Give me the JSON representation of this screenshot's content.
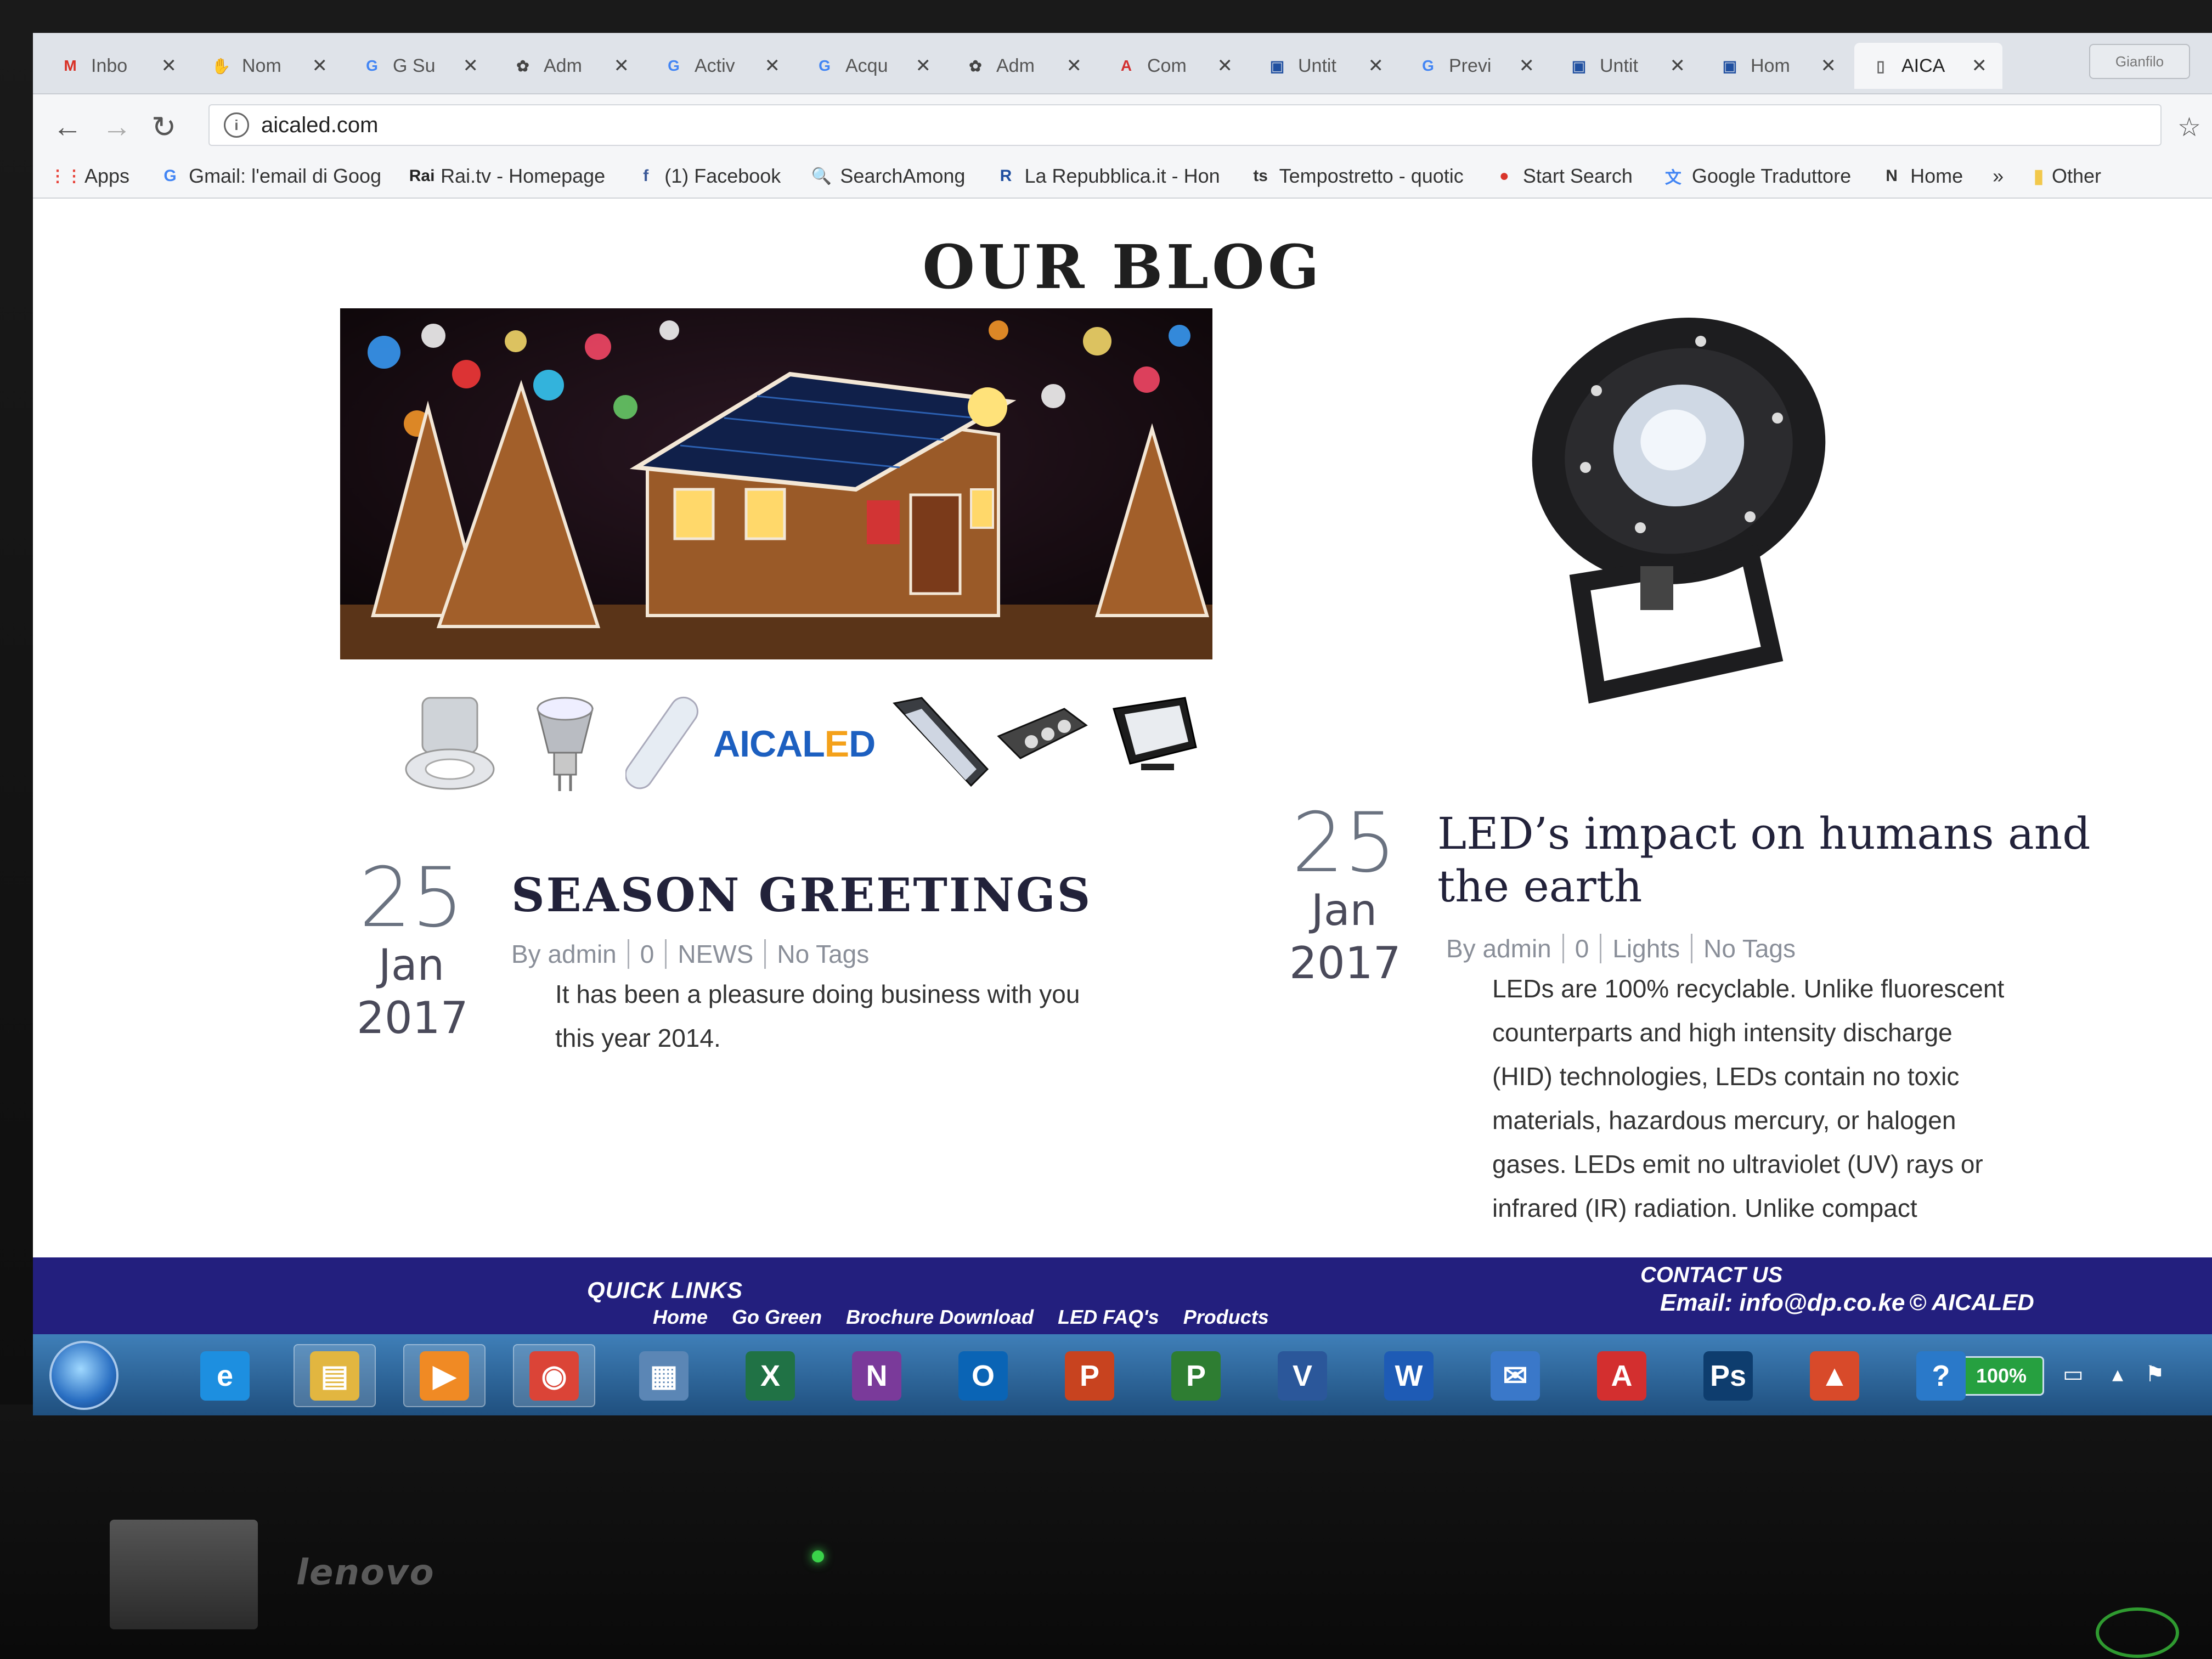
{
  "browser": {
    "tabs": [
      {
        "label": "Inbo",
        "icon": "gmail-icon",
        "glyph": "M",
        "color": "#d93025",
        "bg": "transparent"
      },
      {
        "label": "Nom",
        "icon": "hand-icon",
        "glyph": "✋",
        "color": "#666",
        "bg": "transparent"
      },
      {
        "label": "G Su",
        "icon": "google-icon",
        "glyph": "G",
        "color": "#4285f4",
        "bg": "transparent"
      },
      {
        "label": "Adm",
        "icon": "joomla-icon",
        "glyph": "✿",
        "color": "#444",
        "bg": "transparent"
      },
      {
        "label": "Activ",
        "icon": "google-icon",
        "glyph": "G",
        "color": "#4285f4",
        "bg": "transparent"
      },
      {
        "label": "Acqu",
        "icon": "google-icon",
        "glyph": "G",
        "color": "#4285f4",
        "bg": "transparent"
      },
      {
        "label": "Adm",
        "icon": "joomla-icon",
        "glyph": "✿",
        "color": "#444",
        "bg": "transparent"
      },
      {
        "label": "Com",
        "icon": "acrobat-icon",
        "glyph": "A",
        "color": "#d32f2f",
        "bg": "transparent"
      },
      {
        "label": "Untit",
        "icon": "window-icon",
        "glyph": "▣",
        "color": "#1f4fa0",
        "bg": "transparent"
      },
      {
        "label": "Previ",
        "icon": "google-icon",
        "glyph": "G",
        "color": "#4285f4",
        "bg": "transparent"
      },
      {
        "label": "Untit",
        "icon": "window-icon",
        "glyph": "▣",
        "color": "#1f4fa0",
        "bg": "transparent"
      },
      {
        "label": "Hom",
        "icon": "window-icon",
        "glyph": "▣",
        "color": "#1f4fa0",
        "bg": "transparent"
      },
      {
        "label": "AICA",
        "icon": "page-icon",
        "glyph": "▯",
        "color": "#666",
        "bg": "transparent",
        "active": true
      }
    ],
    "window_control_label": "Gianfilo",
    "url": "aicaled.com",
    "bookmarks": [
      {
        "label": "Apps",
        "icon": "apps-grid-icon",
        "glyph": "⋮⋮",
        "color": "#e8453c"
      },
      {
        "label": "Gmail: l'email di Goog",
        "icon": "google-icon",
        "glyph": "G",
        "color": "#4285f4"
      },
      {
        "label": "Rai.tv - Homepage",
        "icon": "rai-icon",
        "glyph": "Rai",
        "color": "#222"
      },
      {
        "label": "(1) Facebook",
        "icon": "facebook-icon",
        "glyph": "f",
        "color": "#3b5998"
      },
      {
        "label": "SearchAmong",
        "icon": "magnifier-icon",
        "glyph": "🔍",
        "color": "#3a78c9"
      },
      {
        "label": "La Repubblica.it - Hon",
        "icon": "repubblica-icon",
        "glyph": "R",
        "color": "#1f4fa0"
      },
      {
        "label": "Tempostretto - quotic",
        "icon": "ts-icon",
        "glyph": "ts",
        "color": "#333"
      },
      {
        "label": "Start Search",
        "icon": "start-search-icon",
        "glyph": "●",
        "color": "#d9352b"
      },
      {
        "label": "Google Traduttore",
        "icon": "translate-icon",
        "glyph": "文",
        "color": "#4285f4"
      },
      {
        "label": "Home",
        "icon": "home-n-icon",
        "glyph": "N",
        "color": "#333"
      }
    ],
    "overflow_label": "»",
    "other_label": "Other"
  },
  "page": {
    "heading": "OUR BLOG",
    "logo": {
      "main": "AICAL",
      "accent": "E",
      "tail": "D"
    },
    "posts": [
      {
        "day": "25",
        "month": "Jan",
        "year": "2017",
        "title": "SEASON GREETINGS",
        "meta": [
          "By admin",
          "0",
          "NEWS",
          "No Tags"
        ],
        "excerpt_lines": [
          "It has been a pleasure doing business with you",
          "this year 2014."
        ]
      },
      {
        "day": "25",
        "month": "Jan",
        "year": "2017",
        "title_lines": [
          "LED’s impact on humans and",
          "the earth"
        ],
        "meta": [
          "By admin",
          "0",
          "Lights",
          "No Tags"
        ],
        "excerpt_lines": [
          "LEDs are 100% recyclable. Unlike fluorescent",
          "counterparts and high intensity discharge",
          "(HID) technologies, LEDs contain no toxic",
          "materials, hazardous mercury, or halogen",
          "gases. LEDs emit no ultraviolet (UV) rays or",
          "infrared (IR) radiation. Unlike compact"
        ]
      }
    ],
    "footer": {
      "quick_links_title": "QUICK LINKS",
      "quick_links": [
        "Home",
        "Go Green",
        "Brochure Download",
        "LED FAQ's",
        "Products"
      ],
      "contact_title": "CONTACT US",
      "email": "Email: info@dp.co.ke",
      "copyright": "© AICALED"
    }
  },
  "taskbar": {
    "battery": "100%",
    "apps": [
      {
        "name": "internet-explorer-icon",
        "glyph": "e",
        "bg": "#1d8fe0"
      },
      {
        "name": "file-explorer-icon",
        "glyph": "▤",
        "bg": "#e2b640"
      },
      {
        "name": "media-player-icon",
        "glyph": "▶",
        "bg": "#f08a24"
      },
      {
        "name": "chrome-icon",
        "glyph": "◉",
        "bg": "#db4437"
      },
      {
        "name": "app-window-icon",
        "glyph": "▦",
        "bg": "#5b86b5"
      },
      {
        "name": "excel-icon",
        "glyph": "X",
        "bg": "#207245"
      },
      {
        "name": "onenote-icon",
        "glyph": "N",
        "bg": "#7a3a9a"
      },
      {
        "name": "outlook-icon",
        "glyph": "O",
        "bg": "#0a64b5"
      },
      {
        "name": "powerpoint-icon",
        "glyph": "P",
        "bg": "#c8431f"
      },
      {
        "name": "project-icon",
        "glyph": "P",
        "bg": "#2e7d32"
      },
      {
        "name": "visio-icon",
        "glyph": "V",
        "bg": "#2b579a"
      },
      {
        "name": "word-icon",
        "glyph": "W",
        "bg": "#1e5bb5"
      },
      {
        "name": "thunderbird-icon",
        "glyph": "✉",
        "bg": "#3a78c9"
      },
      {
        "name": "acrobat-icon",
        "glyph": "A",
        "bg": "#d32f2f"
      },
      {
        "name": "photoshop-icon",
        "glyph": "Ps",
        "bg": "#0e3d6e"
      },
      {
        "name": "office-upload-icon",
        "glyph": "▲",
        "bg": "#d84a2a"
      },
      {
        "name": "help-icon",
        "glyph": "?",
        "bg": "#2a79c9"
      }
    ]
  },
  "device": {
    "brand": "lenovo"
  }
}
